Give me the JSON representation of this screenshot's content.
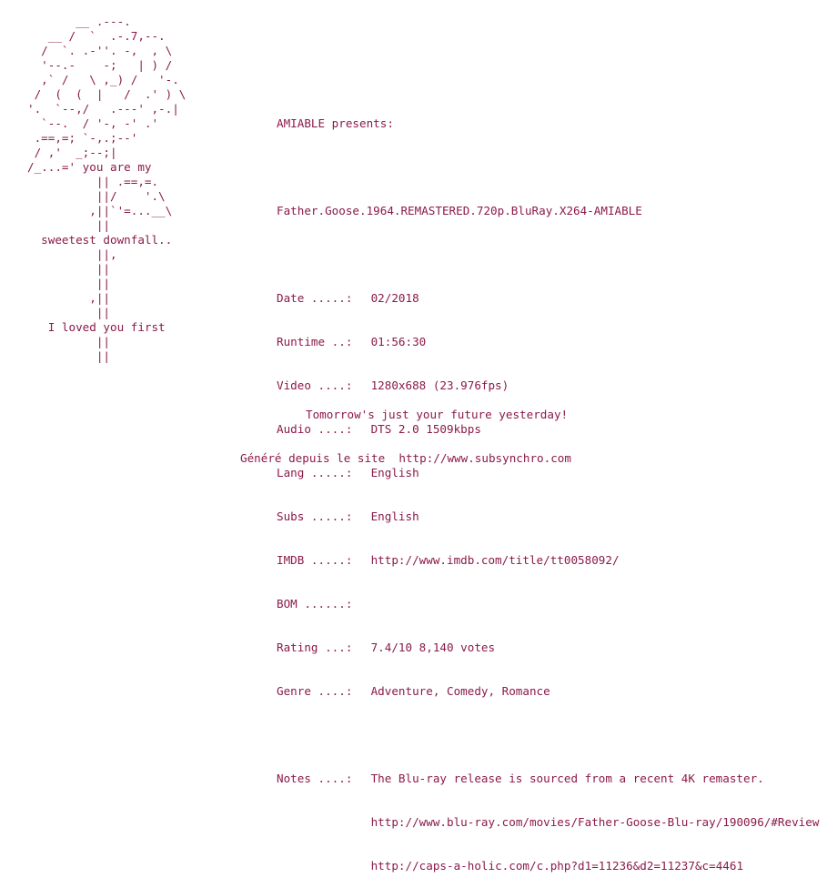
{
  "ascii_art": "       __ .---.\n   __ /  `  .-.7,--.\n  /  `. .-''. -,  , \\\n  '--.-    -;   | ) /\n  ,` /   \\ ,_) /   '-.\n /  (  (  |   /  .' ) \\\n'.  `--,/   .---' ,-.|\n  `--.  / '-, -' .'\n .==,=; `-,.;--'\n / ,'  _;--;|\n/_...=' you are my\n          || .==,=.\n          ||/    '.\\\n         ,||`'=...__\\\n          ||\n  sweetest downfall..\n          ||,\n          ||\n          ||\n         ,||\n          ||\n   I loved you first\n          ||\n          ||",
  "presents": "AMIABLE presents:",
  "release_name": "Father.Goose.1964.REMASTERED.720p.BluRay.X264-AMIABLE",
  "fields": {
    "date": {
      "label": "Date .....:",
      "value": " 02/2018"
    },
    "runtime": {
      "label": "Runtime ..:",
      "value": " 01:56:30"
    },
    "video": {
      "label": "Video ....:",
      "value": " 1280x688 (23.976fps)"
    },
    "audio": {
      "label": "Audio ....:",
      "value": " DTS 2.0 1509kbps"
    },
    "lang": {
      "label": "Lang .....:",
      "value": " English"
    },
    "subs": {
      "label": "Subs .....:",
      "value": " English"
    },
    "imdb": {
      "label": "IMDB .....:",
      "value": " http://www.imdb.com/title/tt0058092/"
    },
    "bom": {
      "label": "BOM ......:",
      "value": ""
    },
    "rating": {
      "label": "Rating ...:",
      "value": " 7.4/10 8,140 votes"
    },
    "genre": {
      "label": "Genre ....:",
      "value": " Adventure, Comedy, Romance"
    },
    "notes": {
      "label": "Notes ....:",
      "value": " The Blu-ray release is sourced from a recent 4K remaster."
    }
  },
  "notes_links": [
    "http://www.blu-ray.com/movies/Father-Goose-Blu-ray/190096/#Review",
    "http://caps-a-holic.com/c.php?d1=11236&d2=11237&c=4461"
  ],
  "tagline": "Tomorrow's just your future yesterday!",
  "footer": "Généré depuis le site  http://www.subsynchro.com",
  "colors": {
    "text": "#8b1a4a",
    "background": "#ffffff"
  }
}
